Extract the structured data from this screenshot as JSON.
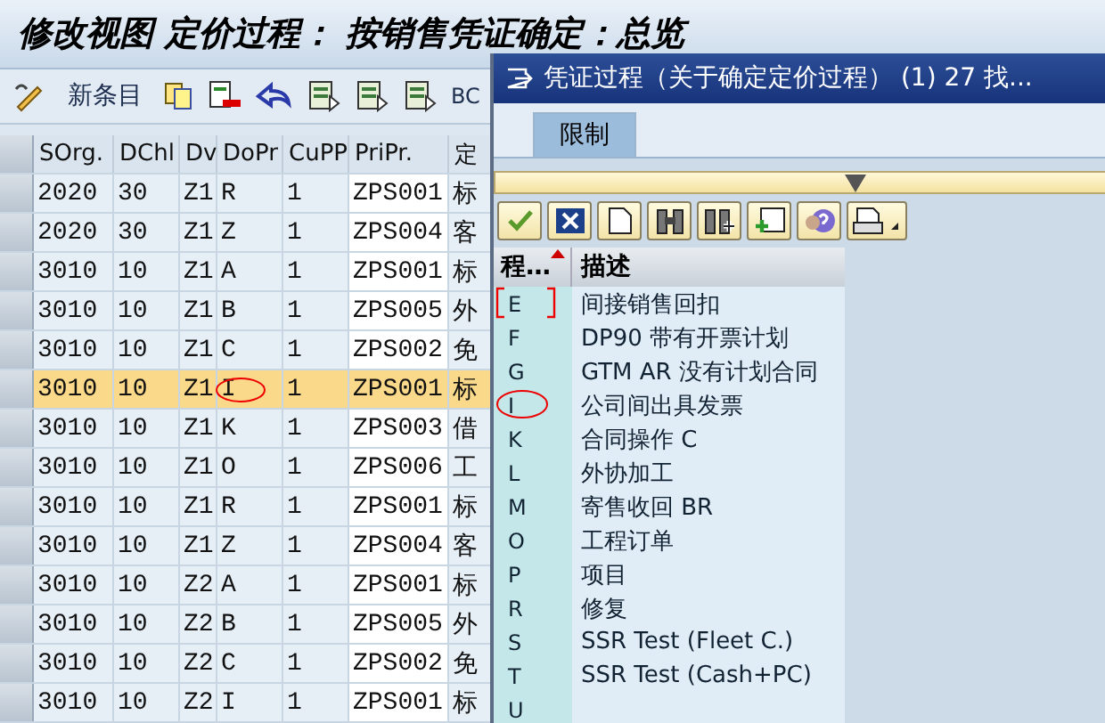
{
  "window": {
    "title": "修改视图 定价过程： 按销售凭证确定：总览"
  },
  "toolbar": {
    "new_entry": "新条目",
    "cut_label": "BC"
  },
  "table": {
    "columns": [
      "SOrg.",
      "DChl",
      "Dv",
      "DoPr",
      "CuPP",
      "PriPr.",
      "定"
    ],
    "rows": [
      {
        "cells": [
          "2020",
          "30",
          "Z1",
          "R",
          "1",
          "ZPS001",
          "标"
        ],
        "selected": false,
        "circled": false
      },
      {
        "cells": [
          "2020",
          "30",
          "Z1",
          "Z",
          "1",
          "ZPS004",
          "客"
        ],
        "selected": false,
        "circled": false
      },
      {
        "cells": [
          "3010",
          "10",
          "Z1",
          "A",
          "1",
          "ZPS001",
          "标"
        ],
        "selected": false,
        "circled": false
      },
      {
        "cells": [
          "3010",
          "10",
          "Z1",
          "B",
          "1",
          "ZPS005",
          "外"
        ],
        "selected": false,
        "circled": false
      },
      {
        "cells": [
          "3010",
          "10",
          "Z1",
          "C",
          "1",
          "ZPS002",
          "免"
        ],
        "selected": false,
        "circled": false
      },
      {
        "cells": [
          "3010",
          "10",
          "Z1",
          "I",
          "1",
          "ZPS001",
          "标"
        ],
        "selected": true,
        "circled": true
      },
      {
        "cells": [
          "3010",
          "10",
          "Z1",
          "K",
          "1",
          "ZPS003",
          "借"
        ],
        "selected": false,
        "circled": false
      },
      {
        "cells": [
          "3010",
          "10",
          "Z1",
          "O",
          "1",
          "ZPS006",
          "工"
        ],
        "selected": false,
        "circled": false
      },
      {
        "cells": [
          "3010",
          "10",
          "Z1",
          "R",
          "1",
          "ZPS001",
          "标"
        ],
        "selected": false,
        "circled": false
      },
      {
        "cells": [
          "3010",
          "10",
          "Z1",
          "Z",
          "1",
          "ZPS004",
          "客"
        ],
        "selected": false,
        "circled": false
      },
      {
        "cells": [
          "3010",
          "10",
          "Z2",
          "A",
          "1",
          "ZPS001",
          "标"
        ],
        "selected": false,
        "circled": false
      },
      {
        "cells": [
          "3010",
          "10",
          "Z2",
          "B",
          "1",
          "ZPS005",
          "外"
        ],
        "selected": false,
        "circled": false
      },
      {
        "cells": [
          "3010",
          "10",
          "Z2",
          "C",
          "1",
          "ZPS002",
          "免"
        ],
        "selected": false,
        "circled": false
      },
      {
        "cells": [
          "3010",
          "10",
          "Z2",
          "I",
          "1",
          "ZPS001",
          "标"
        ],
        "selected": false,
        "circled": false
      }
    ]
  },
  "dialog": {
    "title": "凭证过程（关于确定定价过程） (1)  27 找...",
    "tabs": [
      {
        "label": "限制",
        "selected": true
      }
    ],
    "columns": [
      "程…",
      "描述"
    ],
    "rows": [
      {
        "code": "E",
        "text": "间接销售回扣",
        "bracketed": true,
        "circled": false
      },
      {
        "code": "F",
        "text": "DP90 带有开票计划",
        "bracketed": false,
        "circled": false
      },
      {
        "code": "G",
        "text": "GTM AR 没有计划合同",
        "bracketed": false,
        "circled": false
      },
      {
        "code": "I",
        "text": "公司间出具发票",
        "bracketed": false,
        "circled": true
      },
      {
        "code": "K",
        "text": "合同操作 C",
        "bracketed": false,
        "circled": false
      },
      {
        "code": "L",
        "text": "外协加工",
        "bracketed": false,
        "circled": false
      },
      {
        "code": "M",
        "text": "寄售收回 BR",
        "bracketed": false,
        "circled": false
      },
      {
        "code": "O",
        "text": "工程订单",
        "bracketed": false,
        "circled": false
      },
      {
        "code": "P",
        "text": "项目",
        "bracketed": false,
        "circled": false
      },
      {
        "code": "R",
        "text": "修复",
        "bracketed": false,
        "circled": false
      },
      {
        "code": "S",
        "text": "SSR Test (Fleet C.)",
        "bracketed": false,
        "circled": false
      },
      {
        "code": "T",
        "text": "SSR Test (Cash+PC)",
        "bracketed": false,
        "circled": false
      },
      {
        "code": "U",
        "bracketed": false,
        "circled": false
      }
    ]
  }
}
